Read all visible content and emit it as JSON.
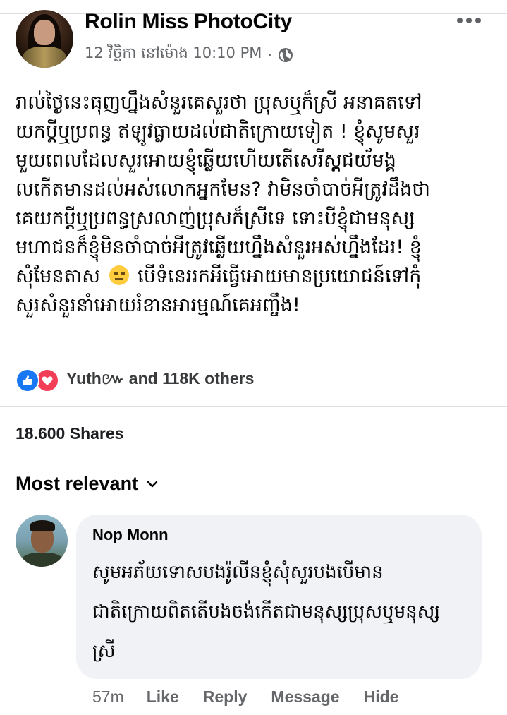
{
  "post": {
    "author": "Rolin Miss PhotoCity",
    "timestamp": "12 វិច្ឆិកា នៅម៉ោង 10:10 PM",
    "separator": "·",
    "audience_icon": "globe-icon",
    "more_icon": "more-horizontal-icon",
    "body_lines": [
      "រាល់ថ្ងៃនេះធុញហ្នឹងសំនួរគេសួរថា ប្រុសឬក៏ស្រី អនាគតទៅ",
      "យកប្តីឬប្រពន្ធ ឥឡូវធ្លាយដល់ជាតិក្រោយទៀត !  ខ្ញុំសូមសួរ",
      "មួយពេលដែលសួរអោយខ្ញុំឆ្លើយហើយតើសេរីស្ព្តជយ័មង្គ",
      "លកើតមានដល់អស់លោកអ្នកមែន? វាមិនចាំបាច់អីត្រូវដឹងថា",
      "គេយកប្តីឬប្រពន្ធស្រលាញ់ប្រុសក៏ស្រីទេ ទោះបីខ្ញុំជាមនុស្ស",
      "មហាជនក៏ខ្ញុំមិនចាំបាច់អីត្រូវឆ្លើយហ្នឹងសំនួរអស់ហ្នឹងដែរ! ខ្ញុំ"
    ],
    "body_line7_before_emoji": "សុំមែនតាស",
    "body_line7_after_emoji": "បើទំនេររកអីធ្វើអោយមានប្រយោជន៍ទៅកុំ",
    "body_line8": "សួរសំនួរនាំអោយរំខានអារម្មណ៍គេអញ្ចឹង!",
    "emoji_icon": "neutral-face-emoji-icon"
  },
  "reactions": {
    "icons": [
      "like-icon",
      "love-icon"
    ],
    "text": "Yuth៚ and 118K others"
  },
  "shares_text": "18.600 Shares",
  "sort": {
    "label": "Most relevant",
    "icon": "chevron-down-icon"
  },
  "comment": {
    "author": "Nop Monn",
    "lines": [
      "សូមអភ័យទោសបងរ៉ូលីនខ្ញុំសុំសួរបងបើមាន",
      "ជាតិក្រោយពិតតើបងចង់កើតជាមនុស្សប្រុសឬមនុស្ស",
      "ស្រី"
    ],
    "time": "57m",
    "actions": [
      "Like",
      "Reply",
      "Message",
      "Hide"
    ]
  },
  "colors": {
    "like_blue": "#1877f2",
    "love_red": "#f33e58",
    "meta_gray": "#65676b",
    "bubble_bg": "#f0f2f5"
  }
}
